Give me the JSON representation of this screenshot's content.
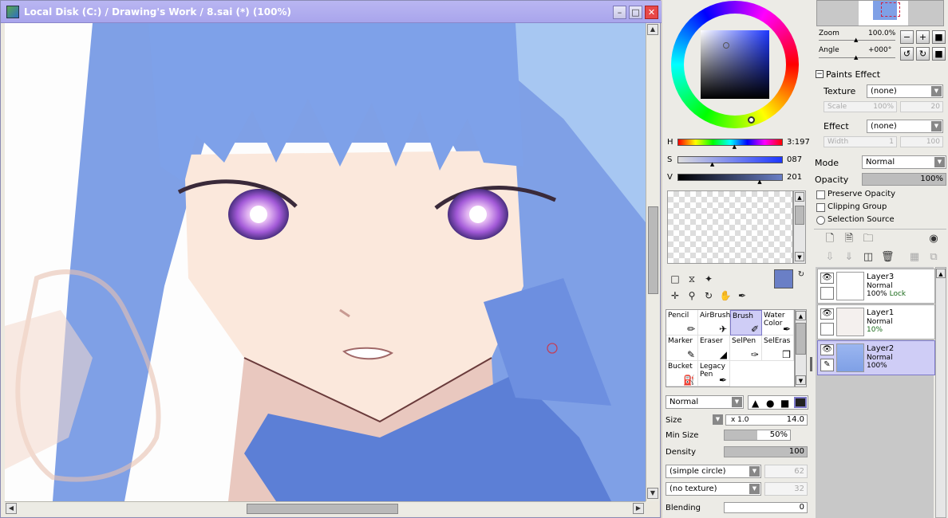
{
  "window": {
    "title": "Local Disk (C:) / Drawing's Work / 8.sai (*) (100%)"
  },
  "colors": {
    "accent": "#a9a5ec",
    "primary_color": "#6a7fc6",
    "hair": "#7fa0e6",
    "skin": "#fbe8dc"
  },
  "color_sliders": [
    {
      "label": "H",
      "value": "3:197",
      "level": 0.55
    },
    {
      "label": "S",
      "value": "087",
      "level": 0.34
    },
    {
      "label": "V",
      "value": "201",
      "level": 0.79
    }
  ],
  "brushes": [
    {
      "label": "Pencil",
      "icon": "pencil-icon"
    },
    {
      "label": "AirBrush",
      "icon": "airbrush-icon"
    },
    {
      "label": "Brush",
      "icon": "brush-icon",
      "selected": true
    },
    {
      "label": "Water Color",
      "icon": "watercolor-icon"
    },
    {
      "label": "Marker",
      "icon": "marker-icon"
    },
    {
      "label": "Eraser",
      "icon": "eraser-icon"
    },
    {
      "label": "SelPen",
      "icon": "selpen-icon"
    },
    {
      "label": "SelEras",
      "icon": "seleras-icon"
    },
    {
      "label": "Bucket",
      "icon": "bucket-icon"
    },
    {
      "label": "Legacy Pen",
      "icon": "legacy-pen-icon"
    }
  ],
  "brush_settings": {
    "blend_mode": "Normal",
    "size_label": "Size",
    "size_mult": "x 1.0",
    "size_value": "14.0",
    "min_size_label": "Min Size",
    "min_size_value": "50%",
    "min_size_level": 0.5,
    "density_label": "Density",
    "density_value": "100",
    "density_level": 1.0,
    "shape": "(simple circle)",
    "shape_value": "62",
    "texture": "(no texture)",
    "texture_value": "32",
    "blending_label": "Blending",
    "blending_value": "0"
  },
  "navigator": {
    "zoom_label": "Zoom",
    "zoom_value": "100.0%",
    "angle_label": "Angle",
    "angle_value": "+000°"
  },
  "paints_effect": {
    "header": "Paints Effect",
    "texture_label": "Texture",
    "texture_value": "(none)",
    "scale_label": "Scale",
    "scale_value": "100%",
    "scale_num": "20",
    "effect_label": "Effect",
    "effect_value": "(none)",
    "width_label": "Width",
    "width_value": "1",
    "width_num": "100"
  },
  "layer_settings": {
    "mode_label": "Mode",
    "mode_value": "Normal",
    "opacity_label": "Opacity",
    "opacity_value": "100%",
    "opacity_level": 1.0,
    "preserve_opacity": "Preserve Opacity",
    "clipping_group": "Clipping Group",
    "selection_source": "Selection Source"
  },
  "layers": [
    {
      "name": "Layer3",
      "mode": "Normal",
      "opacity": "100%",
      "lock": "Lock",
      "selected": false
    },
    {
      "name": "Layer1",
      "mode": "Normal",
      "opacity": "10%",
      "lock": "",
      "selected": false
    },
    {
      "name": "Layer2",
      "mode": "Normal",
      "opacity": "100%",
      "lock": "",
      "selected": true
    }
  ]
}
